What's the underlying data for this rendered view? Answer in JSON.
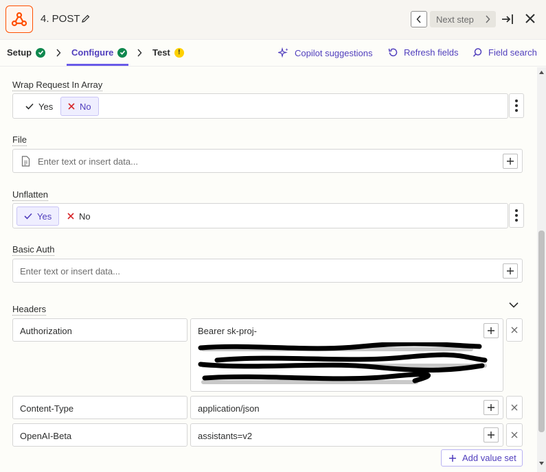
{
  "header": {
    "step_title": "4. POST",
    "next_step_label": "Next step",
    "icon": "webhook-icon"
  },
  "tabs": {
    "setup": "Setup",
    "configure": "Configure",
    "test": "Test",
    "test_warning": "!"
  },
  "actions": {
    "copilot": "Copilot suggestions",
    "refresh": "Refresh fields",
    "search": "Field search"
  },
  "fields": {
    "wrap_request": {
      "label": "Wrap Request In Array",
      "yes": "Yes",
      "no": "No",
      "selected": "No"
    },
    "file": {
      "label": "File",
      "placeholder": "Enter text or insert data..."
    },
    "unflatten": {
      "label": "Unflatten",
      "yes": "Yes",
      "no": "No",
      "selected": "Yes"
    },
    "basic_auth": {
      "label": "Basic Auth",
      "placeholder": "Enter text or insert data..."
    },
    "headers": {
      "label": "Headers",
      "rows": [
        {
          "key": "Authorization",
          "value": "Bearer sk-proj-"
        },
        {
          "key": "Content-Type",
          "value": "application/json"
        },
        {
          "key": "OpenAI-Beta",
          "value": "assistants=v2"
        }
      ],
      "add_label": "Add value set"
    }
  },
  "colors": {
    "accent": "#503ebd",
    "brand": "#ff4f00",
    "success": "#0f884e",
    "warning": "#ffd000"
  }
}
